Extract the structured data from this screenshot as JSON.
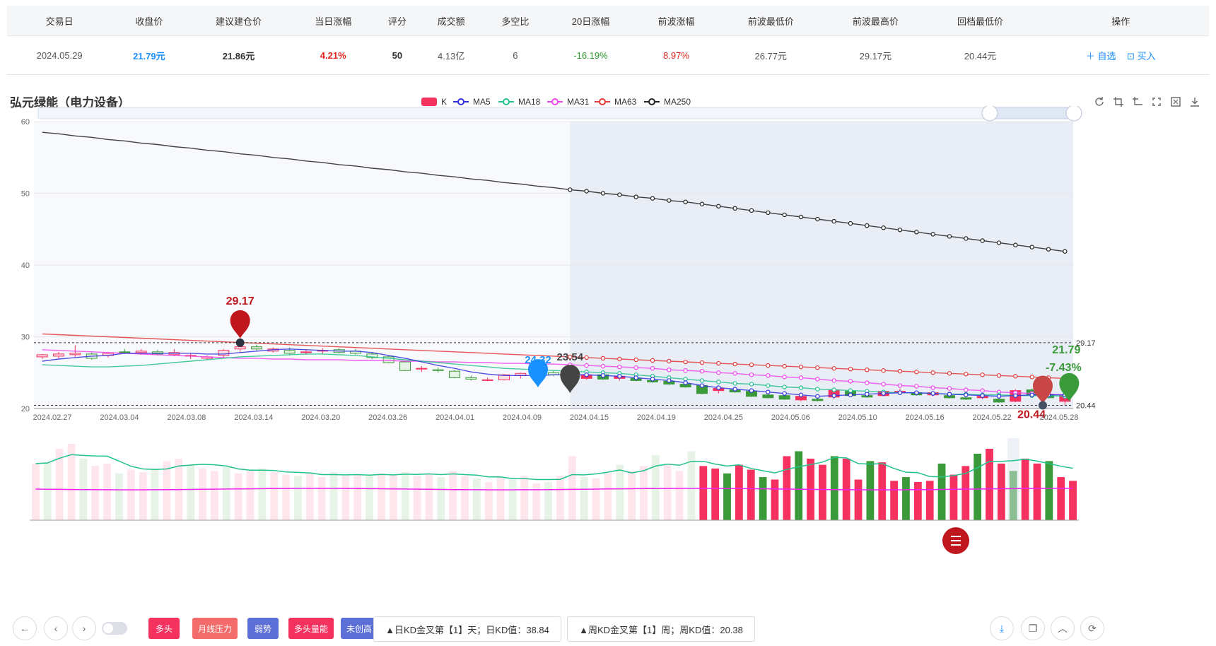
{
  "table": {
    "headers": [
      "交易日",
      "收盘价",
      "建议建仓价",
      "当日涨幅",
      "评分",
      "成交额",
      "多空比",
      "20日涨幅",
      "前波涨幅",
      "前波最低价",
      "前波最高价",
      "回档最低价",
      "操作"
    ],
    "row": {
      "date": "2024.05.29",
      "close": "21.79元",
      "suggested_price": "21.86元",
      "daily_change": "4.21%",
      "score": "50",
      "turnover": "4.13亿",
      "long_short_ratio": "6",
      "change_20d": "-16.19%",
      "prev_wave_change": "8.97%",
      "prev_wave_low": "26.77元",
      "prev_wave_high": "29.17元",
      "pullback_low": "20.44元"
    },
    "actions": {
      "watch": "＋ 自选",
      "buy": "⊡ 买入"
    }
  },
  "colors": {
    "up": "#f5315f",
    "down": "#3a9a3a",
    "blue": "#1890ff",
    "ma5": "#3333dd",
    "ma18": "#23c28c",
    "ma31": "#ee44ee",
    "ma63": "#e03a3a",
    "ma250": "#222222"
  },
  "chart_data": {
    "type": "candlestick",
    "title": "弘元绿能（电力设备）",
    "legend": [
      "K",
      "MA5",
      "MA18",
      "MA31",
      "MA63",
      "MA250"
    ],
    "ylim": [
      20,
      60
    ],
    "yticks": [
      20,
      30,
      40,
      50,
      60
    ],
    "x_tick_labels": [
      "2024.02.27",
      "2024.03.04",
      "2024.03.08",
      "2024.03.14",
      "2024.03.20",
      "2024.03.26",
      "2024.04.01",
      "2024.04.09",
      "2024.04.15",
      "2024.04.19",
      "2024.04.25",
      "2024.05.06",
      "2024.05.10",
      "2024.05.16",
      "2024.05.22",
      "2024.05.28"
    ],
    "n_days": 63,
    "ohlc": [
      [
        27.2,
        27.6,
        26.9,
        27.5
      ],
      [
        27.3,
        27.9,
        27.0,
        27.6
      ],
      [
        27.5,
        28.8,
        27.2,
        27.7
      ],
      [
        27.6,
        27.8,
        26.8,
        27.0
      ],
      [
        27.4,
        27.9,
        27.1,
        27.7
      ],
      [
        27.9,
        28.3,
        27.6,
        27.8
      ],
      [
        27.8,
        28.3,
        27.5,
        28.0
      ],
      [
        27.9,
        28.2,
        27.4,
        27.6
      ],
      [
        27.5,
        28.3,
        27.3,
        27.8
      ],
      [
        27.3,
        27.7,
        26.9,
        27.4
      ],
      [
        27.0,
        27.4,
        26.8,
        27.2
      ],
      [
        27.4,
        28.3,
        27.1,
        28.1
      ],
      [
        28.3,
        29.17,
        27.8,
        28.6
      ],
      [
        28.6,
        28.9,
        28.1,
        28.3
      ],
      [
        28.0,
        28.5,
        27.8,
        28.3
      ],
      [
        28.1,
        28.5,
        27.4,
        27.7
      ],
      [
        27.9,
        28.2,
        27.5,
        27.9
      ],
      [
        28.0,
        28.4,
        27.6,
        28.1
      ],
      [
        28.2,
        28.4,
        27.7,
        27.8
      ],
      [
        28.0,
        28.3,
        27.5,
        27.7
      ],
      [
        27.6,
        27.9,
        26.9,
        27.1
      ],
      [
        27.2,
        27.4,
        26.3,
        26.4
      ],
      [
        26.5,
        26.6,
        25.2,
        25.3
      ],
      [
        25.5,
        25.9,
        25.1,
        25.6
      ],
      [
        25.4,
        25.7,
        25.0,
        25.3
      ],
      [
        25.2,
        25.4,
        24.2,
        24.3
      ],
      [
        24.3,
        24.6,
        23.9,
        24.1
      ],
      [
        24.0,
        24.3,
        23.8,
        24.0
      ],
      [
        24.0,
        24.8,
        23.9,
        24.7
      ],
      [
        24.6,
        25.0,
        24.2,
        24.9
      ],
      [
        25.0,
        25.4,
        24.6,
        25.3
      ],
      [
        25.0,
        25.3,
        24.5,
        24.7
      ],
      [
        24.7,
        24.9,
        24.0,
        24.1
      ],
      [
        24.2,
        24.8,
        24.0,
        24.7
      ],
      [
        24.7,
        24.9,
        24.0,
        24.1
      ],
      [
        24.2,
        24.8,
        23.9,
        24.5
      ],
      [
        24.2,
        24.4,
        23.8,
        23.9
      ],
      [
        23.9,
        24.1,
        23.6,
        23.7
      ],
      [
        23.8,
        24.0,
        23.3,
        23.4
      ],
      [
        23.4,
        23.6,
        22.9,
        23.0
      ],
      [
        23.2,
        23.4,
        22.0,
        22.1
      ],
      [
        22.5,
        23.0,
        22.1,
        22.8
      ],
      [
        22.6,
        22.8,
        22.2,
        22.3
      ],
      [
        22.4,
        22.6,
        21.6,
        21.7
      ],
      [
        21.9,
        22.1,
        21.4,
        21.5
      ],
      [
        21.8,
        22.0,
        21.2,
        21.3
      ],
      [
        21.2,
        21.8,
        21.0,
        21.7
      ],
      [
        21.3,
        21.6,
        21.0,
        21.1
      ],
      [
        21.6,
        22.7,
        21.3,
        22.6
      ],
      [
        22.4,
        22.8,
        21.7,
        21.8
      ],
      [
        21.8,
        22.1,
        21.5,
        21.6
      ],
      [
        21.8,
        22.6,
        21.7,
        22.4
      ],
      [
        22.3,
        22.8,
        22.1,
        22.4
      ],
      [
        22.2,
        22.5,
        21.8,
        21.9
      ],
      [
        21.9,
        22.4,
        21.7,
        22.2
      ],
      [
        21.8,
        22.0,
        21.4,
        21.5
      ],
      [
        21.5,
        21.8,
        21.2,
        21.3
      ],
      [
        21.5,
        21.8,
        21.3,
        21.7
      ],
      [
        21.3,
        21.5,
        20.8,
        20.9
      ],
      [
        21.0,
        22.7,
        20.9,
        22.5
      ],
      [
        22.6,
        22.8,
        21.8,
        21.9
      ],
      [
        22.0,
        22.4,
        21.4,
        21.5
      ],
      [
        21.0,
        22.1,
        20.44,
        21.79
      ]
    ],
    "ma5": [
      26.6,
      26.9,
      27.1,
      27.3,
      27.4,
      27.7,
      27.7,
      27.7,
      27.7,
      27.7,
      27.6,
      27.6,
      27.8,
      28.0,
      28.2,
      28.3,
      28.2,
      28.1,
      28.0,
      28.0,
      27.8,
      27.4,
      27.0,
      26.5,
      26.0,
      25.6,
      25.1,
      24.8,
      24.6,
      24.6,
      24.6,
      24.7,
      24.7,
      24.7,
      24.6,
      24.5,
      24.3,
      24.1,
      23.9,
      23.6,
      23.2,
      22.9,
      22.7,
      22.5,
      22.3,
      22.1,
      21.9,
      21.7,
      21.8,
      21.9,
      22.0,
      22.1,
      22.2,
      22.2,
      22.1,
      22.0,
      21.9,
      21.8,
      21.7,
      21.8,
      21.9,
      21.9,
      21.9
    ],
    "ma18": [
      26.1,
      26.0,
      25.9,
      25.8,
      25.8,
      25.9,
      26.0,
      26.2,
      26.4,
      26.6,
      26.8,
      27.0,
      27.2,
      27.3,
      27.4,
      27.5,
      27.6,
      27.6,
      27.5,
      27.4,
      27.2,
      27.0,
      26.8,
      26.6,
      26.4,
      26.2,
      26.0,
      25.8,
      25.6,
      25.5,
      25.4,
      25.3,
      25.2,
      25.1,
      25.0,
      24.9,
      24.7,
      24.5,
      24.3,
      24.1,
      23.9,
      23.7,
      23.5,
      23.4,
      23.2,
      23.0,
      22.9,
      22.7,
      22.6,
      22.5,
      22.4,
      22.3,
      22.2,
      22.2,
      22.1,
      22.0,
      22.0,
      21.9,
      21.9,
      21.8,
      21.8,
      21.8,
      21.7
    ],
    "ma31": [
      28.2,
      28.1,
      28.0,
      27.9,
      27.8,
      27.7,
      27.6,
      27.5,
      27.4,
      27.3,
      27.2,
      27.1,
      27.0,
      27.0,
      26.9,
      26.9,
      26.8,
      26.8,
      26.8,
      26.7,
      26.7,
      26.7,
      26.6,
      26.6,
      26.5,
      26.5,
      26.4,
      26.4,
      26.3,
      26.3,
      26.2,
      26.2,
      26.1,
      26.0,
      25.9,
      25.8,
      25.7,
      25.6,
      25.4,
      25.3,
      25.2,
      25.0,
      24.9,
      24.7,
      24.6,
      24.4,
      24.3,
      24.1,
      23.9,
      23.8,
      23.6,
      23.4,
      23.2,
      23.1,
      22.9,
      22.8,
      22.6,
      22.5,
      22.3,
      22.2,
      22.1,
      22.0,
      21.9
    ],
    "ma63": [
      30.4,
      30.3,
      30.2,
      30.1,
      30.0,
      29.9,
      29.8,
      29.7,
      29.6,
      29.5,
      29.4,
      29.3,
      29.2,
      29.1,
      29.0,
      28.9,
      28.8,
      28.7,
      28.6,
      28.5,
      28.4,
      28.3,
      28.2,
      28.1,
      28.0,
      27.9,
      27.8,
      27.7,
      27.6,
      27.5,
      27.4,
      27.3,
      27.2,
      27.1,
      27.0,
      26.9,
      26.8,
      26.7,
      26.6,
      26.5,
      26.4,
      26.3,
      26.2,
      26.1,
      26.0,
      25.9,
      25.8,
      25.7,
      25.6,
      25.5,
      25.4,
      25.3,
      25.2,
      25.1,
      25.0,
      24.9,
      24.8,
      24.7,
      24.6,
      24.5,
      24.4,
      24.3,
      24.2
    ],
    "ma250": [
      58.5,
      58.3,
      58.0,
      57.8,
      57.5,
      57.3,
      57.0,
      56.8,
      56.5,
      56.3,
      56.0,
      55.8,
      55.5,
      55.3,
      55.0,
      54.8,
      54.5,
      54.3,
      54.0,
      53.8,
      53.5,
      53.3,
      53.0,
      52.8,
      52.5,
      52.3,
      52.0,
      51.8,
      51.5,
      51.3,
      51.0,
      50.8,
      50.5,
      50.3,
      50.0,
      49.8,
      49.5,
      49.3,
      49.0,
      48.8,
      48.5,
      48.2,
      47.9,
      47.6,
      47.3,
      47.0,
      46.7,
      46.4,
      46.1,
      45.8,
      45.5,
      45.2,
      44.9,
      44.6,
      44.3,
      44.0,
      43.7,
      43.4,
      43.1,
      42.8,
      42.5,
      42.2,
      41.9
    ],
    "volume": [
      46,
      47,
      58,
      62,
      50,
      44,
      46,
      38,
      41,
      39,
      42,
      48,
      50,
      45,
      42,
      40,
      43,
      38,
      40,
      42,
      39,
      37,
      36,
      38,
      35,
      39,
      36,
      37,
      36,
      38,
      37,
      39,
      36,
      38,
      35,
      40,
      36,
      34,
      31,
      35,
      33,
      36,
      30,
      31,
      36,
      52,
      35,
      34,
      38,
      45,
      40,
      44,
      53,
      46,
      40,
      56,
      44,
      42,
      38,
      45,
      41,
      35,
      33,
      52,
      56,
      50,
      45,
      52,
      50,
      33,
      48,
      47,
      32,
      35,
      31,
      32,
      46,
      37,
      44,
      54,
      58,
      46,
      40,
      50,
      46,
      48,
      35,
      32
    ],
    "markers": [
      {
        "label": "29.17",
        "color": "#c0171f"
      },
      {
        "label": "24.32",
        "color": "#1890ff"
      },
      {
        "label": "23.54",
        "color": "#444444"
      },
      {
        "label": "21.79",
        "color": "#3a9a3a"
      },
      {
        "label": "-7.43%",
        "color": "#3a9a3a"
      },
      {
        "label": "20.44",
        "color": "#c0171f"
      }
    ],
    "ref_lines": [
      "29.17",
      "20.44"
    ]
  },
  "buttons": {
    "tags": [
      "多头",
      "月线压力",
      "弱势",
      "多头量能",
      "未创高"
    ],
    "kd_daily": "▲日KD金叉第【1】天；日KD值：38.84",
    "kd_weekly": "▲周KD金叉第【1】周；周KD值：20.38"
  },
  "icons": [
    "restore-icon",
    "zoom-select-icon",
    "zoom-back-icon",
    "expand-icon",
    "fullscreen-icon",
    "download-icon"
  ]
}
